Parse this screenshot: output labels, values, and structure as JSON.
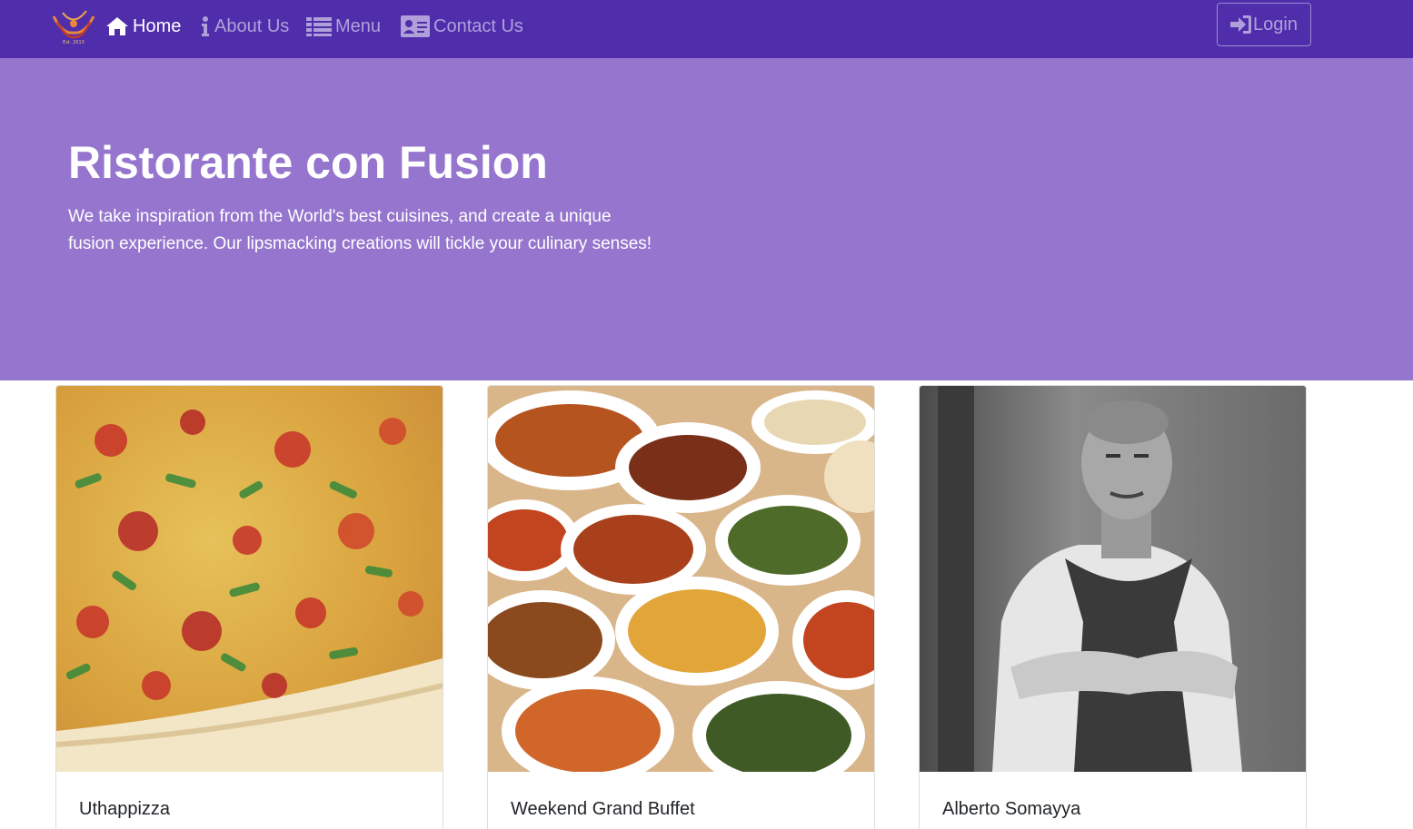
{
  "navbar": {
    "brand_icon": "restaurant-logo",
    "logo_caption": "Est. 2013",
    "links": [
      {
        "label": "Home",
        "icon": "home-icon",
        "active": true
      },
      {
        "label": "About Us",
        "icon": "info-icon",
        "active": false
      },
      {
        "label": "Menu",
        "icon": "list-icon",
        "active": false
      },
      {
        "label": "Contact Us",
        "icon": "address-card-icon",
        "active": false
      }
    ],
    "login_label": "Login",
    "login_icon": "sign-in-icon",
    "background": "#4f2dab"
  },
  "hero": {
    "title": "Ristorante con Fusion",
    "text": "We take inspiration from the World's best cuisines, and create a unique fusion experience. Our lipsmacking creations will tickle your culinary senses!",
    "background": "#9575cd"
  },
  "cards": [
    {
      "title": "Uthappizza",
      "image": "pizza-photo"
    },
    {
      "title": "Weekend Grand Buffet",
      "image": "buffet-photo"
    },
    {
      "title": "Alberto Somayya",
      "image": "chef-photo"
    }
  ]
}
